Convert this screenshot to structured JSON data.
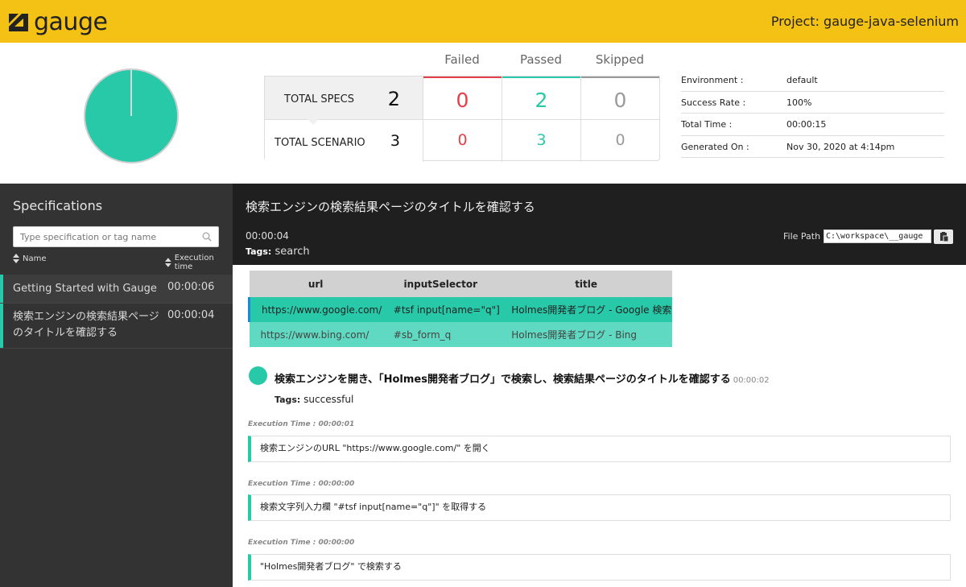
{
  "header": {
    "logo_text": "gauge",
    "project": "Project: gauge-java-selenium"
  },
  "summary": {
    "columns": [
      "Failed",
      "Passed",
      "Skipped"
    ],
    "colors": {
      "failed": "#e3404b",
      "passed": "#27c9a9",
      "skipped": "#9a9a9a",
      "header": "#f4c115"
    },
    "specs": {
      "label": "TOTAL SPECS",
      "total": "2",
      "failed": "0",
      "passed": "2",
      "skipped": "0"
    },
    "scenarios": {
      "label": "TOTAL SCENARIO",
      "total": "3",
      "failed": "0",
      "passed": "3",
      "skipped": "0"
    },
    "pass_fraction": 1.0
  },
  "environment": [
    {
      "key": "Environment :",
      "value": "default"
    },
    {
      "key": "Success Rate :",
      "value": "100%"
    },
    {
      "key": "Total Time :",
      "value": "00:00:15"
    },
    {
      "key": "Generated On :",
      "value": "Nov 30, 2020 at 4:14pm"
    }
  ],
  "sidebar": {
    "title": "Specifications",
    "search_placeholder": "Type specification or tag name",
    "sort_name": "Name",
    "sort_time": "Execution time",
    "items": [
      {
        "name": "Getting Started with Gauge",
        "time": "00:00:06"
      },
      {
        "name": "検索エンジンの検索結果ページのタイトルを確認する",
        "name_line1": "検索エンジンの検索結果ページ",
        "name_line2": "のタイトルを確認する",
        "time": "00:00:04"
      }
    ]
  },
  "spec": {
    "title": "検索エンジンの検索結果ページのタイトルを確認する",
    "time": "00:00:04",
    "tags_label": "Tags:",
    "tags": "search",
    "file_path_label": "File Path",
    "file_path": "C:\\workspace\\__gauge"
  },
  "table": {
    "headers": [
      "url",
      "inputSelector",
      "title"
    ],
    "rows": [
      [
        "https://www.google.com/",
        "#tsf input[name=\"q\"]",
        "Holmes開発者ブログ - Google 検索"
      ],
      [
        "https://www.bing.com/",
        "#sb_form_q",
        "Holmes開発者ブログ - Bing"
      ]
    ]
  },
  "scenario": {
    "title": "検索エンジンを開き、「Holmes開発者ブログ」で検索し、検索結果ページのタイトルを確認する",
    "time": "00:00:02",
    "tags_label": "Tags:",
    "tags": "successful",
    "steps": [
      {
        "exec": "Execution Time : 00:00:01",
        "text": "検索エンジンのURL \"https://www.google.com/\" を開く"
      },
      {
        "exec": "Execution Time : 00:00:00",
        "text": "検索文字列入力欄 \"#tsf input[name=\"q\"]\" を取得する"
      },
      {
        "exec": "Execution Time : 00:00:00",
        "text": "\"Holmes開発者ブログ\" で検索する"
      }
    ]
  }
}
